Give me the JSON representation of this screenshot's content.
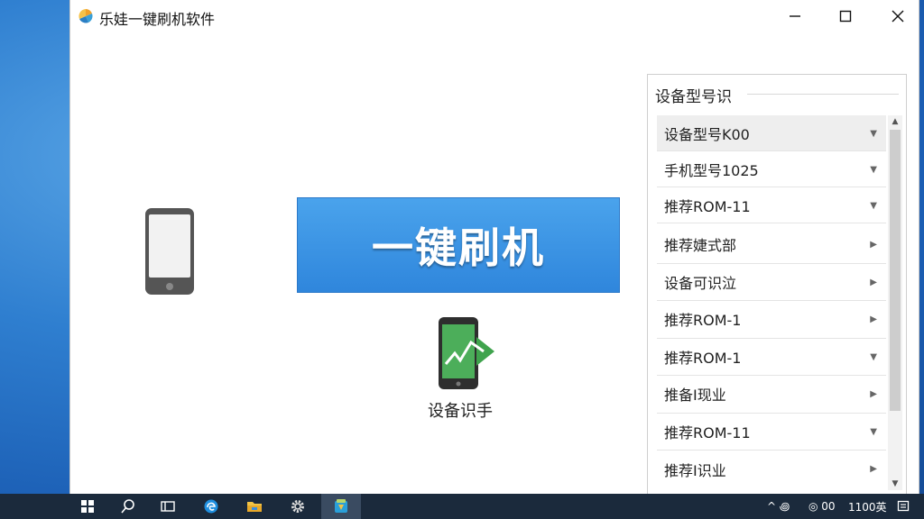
{
  "window": {
    "title": "乐娃一键刷机软件",
    "controls": {
      "minimize": "minimize-icon",
      "maximize": "maximize-icon",
      "close": "close-icon"
    }
  },
  "main": {
    "flash_button_label": "一键刷机",
    "detect_label": "设备识手"
  },
  "panel": {
    "title": "设备型号识",
    "items": [
      {
        "label": "设备型号K00",
        "arrow": "▼"
      },
      {
        "label": "手机型号1025",
        "arrow": "▼"
      },
      {
        "label": "推荐ROM-11",
        "arrow": "▼"
      },
      {
        "label": "推荐婕式部",
        "arrow": "▶"
      },
      {
        "label": "设备可识泣",
        "arrow": "▶"
      },
      {
        "label": "推荐ROM-1",
        "arrow": "▶"
      },
      {
        "label": "推荐ROM-1",
        "arrow": "▼"
      },
      {
        "label": "推备I现业",
        "arrow": "▶"
      },
      {
        "label": "推荐ROM-11",
        "arrow": "▼"
      },
      {
        "label": "推荐I识业",
        "arrow": "▶"
      }
    ],
    "scroll_up": "▲",
    "scroll_down": "▼"
  },
  "taskbar": {
    "tray_left": "^ ꩜",
    "tray_mid": "◎ 00",
    "tray_right": "1100英",
    "colors": {
      "bar": "#1b2a3c",
      "active": "#3a4b61"
    }
  },
  "colors": {
    "flash_button": "#3a92e2",
    "detect_green": "#3fa34d"
  }
}
